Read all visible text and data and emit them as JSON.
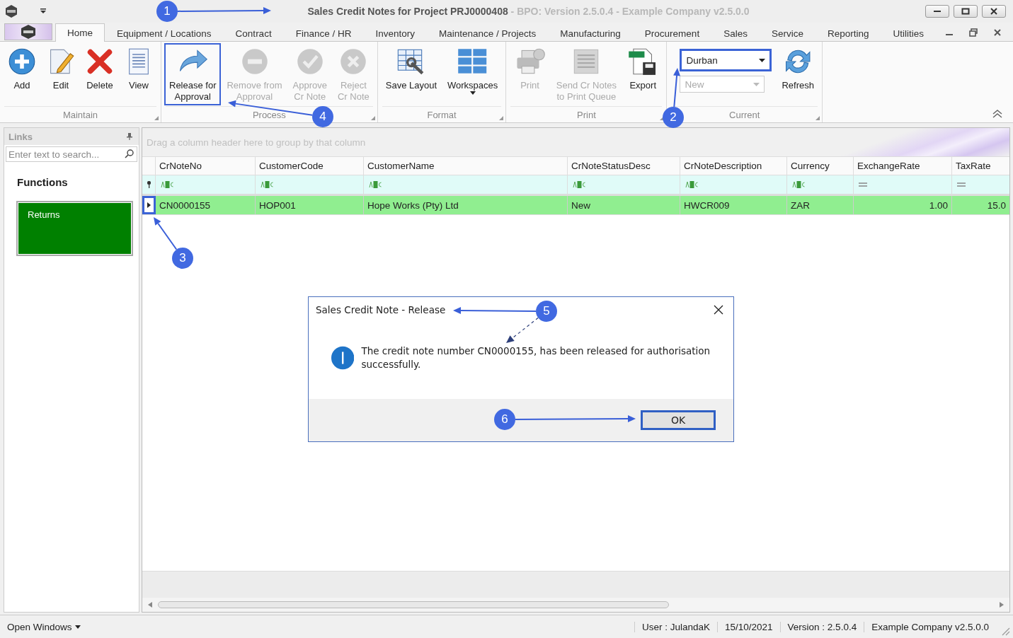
{
  "window": {
    "title": "Sales Credit Notes for Project PRJ0000408",
    "title_suffix": "- BPO: Version 2.5.0.4 - Example Company v2.5.0.0"
  },
  "tabs": [
    {
      "label": "Home",
      "selected": true
    },
    {
      "label": "Equipment / Locations",
      "selected": false
    },
    {
      "label": "Contract",
      "selected": false
    },
    {
      "label": "Finance / HR",
      "selected": false
    },
    {
      "label": "Inventory",
      "selected": false
    },
    {
      "label": "Maintenance / Projects",
      "selected": false
    },
    {
      "label": "Manufacturing",
      "selected": false
    },
    {
      "label": "Procurement",
      "selected": false
    },
    {
      "label": "Sales",
      "selected": false
    },
    {
      "label": "Service",
      "selected": false
    },
    {
      "label": "Reporting",
      "selected": false
    },
    {
      "label": "Utilities",
      "selected": false
    }
  ],
  "ribbon": [
    {
      "label": "Maintain",
      "buttons": [
        {
          "label": "Add",
          "disabled": false,
          "highlighted": false
        },
        {
          "label": "Edit",
          "disabled": false,
          "highlighted": false
        },
        {
          "label": "Delete",
          "disabled": false,
          "highlighted": false
        },
        {
          "label": "View",
          "disabled": false,
          "highlighted": false
        }
      ]
    },
    {
      "label": "Process",
      "buttons": [
        {
          "label": "Release for\nApproval",
          "disabled": false,
          "highlighted": true
        },
        {
          "label": "Remove from\nApproval",
          "disabled": true,
          "highlighted": false
        },
        {
          "label": "Approve\nCr Note",
          "disabled": true,
          "highlighted": false
        },
        {
          "label": "Reject\nCr Note",
          "disabled": true,
          "highlighted": false
        }
      ]
    },
    {
      "label": "Format",
      "buttons": [
        {
          "label": "Save Layout",
          "disabled": false,
          "highlighted": false
        },
        {
          "label": "Workspaces",
          "disabled": false,
          "highlighted": false,
          "kind": "split"
        }
      ]
    },
    {
      "label": "Print",
      "buttons": [
        {
          "label": "Print",
          "disabled": true,
          "highlighted": false
        },
        {
          "label": "Send Cr Notes\nto Print Queue",
          "disabled": true,
          "highlighted": false
        },
        {
          "label": "Export",
          "disabled": false,
          "highlighted": false
        }
      ]
    },
    {
      "label": "Current",
      "dropdowns": [
        {
          "value": "Durban",
          "disabled": false,
          "highlighted": true
        },
        {
          "value": "New",
          "disabled": true,
          "highlighted": false
        }
      ],
      "buttons": [
        {
          "label": "Refresh",
          "disabled": false,
          "highlighted": false
        }
      ]
    }
  ],
  "links": {
    "title": "Links",
    "search_placeholder": "Enter text to search...",
    "section": "Functions",
    "tiles": [
      {
        "label": "Returns"
      }
    ]
  },
  "grid": {
    "group_hint": "Drag a column header here to group by that column",
    "columns": [
      {
        "title": "CrNoteNo",
        "kind": "text"
      },
      {
        "title": "CustomerCode",
        "kind": "text"
      },
      {
        "title": "CustomerName",
        "kind": "text"
      },
      {
        "title": "CrNoteStatusDesc",
        "kind": "text"
      },
      {
        "title": "CrNoteDescription",
        "kind": "text"
      },
      {
        "title": "Currency",
        "kind": "text"
      },
      {
        "title": "ExchangeRate",
        "kind": "number"
      },
      {
        "title": "TaxRate",
        "kind": "number"
      }
    ],
    "rows": [
      {
        "selected": true,
        "highlighted": true,
        "cells": [
          "CN0000155",
          "HOP001",
          "Hope Works (Pty) Ltd",
          "New",
          "HWCR009",
          "ZAR",
          "1.00",
          "15.0"
        ]
      }
    ]
  },
  "dialog": {
    "title": "Sales Credit Note - Release",
    "message": "The credit note number CN0000155, has been released for authorisation successfully.",
    "buttons": [
      {
        "label": "OK",
        "highlighted": true
      }
    ]
  },
  "status_bar": {
    "menu": "Open Windows",
    "items": [
      "User : JulandaK",
      "15/10/2021",
      "Version : 2.5.0.4",
      "Example Company v2.5.0.0"
    ]
  },
  "callouts": [
    "1",
    "2",
    "3",
    "4",
    "5",
    "6"
  ]
}
